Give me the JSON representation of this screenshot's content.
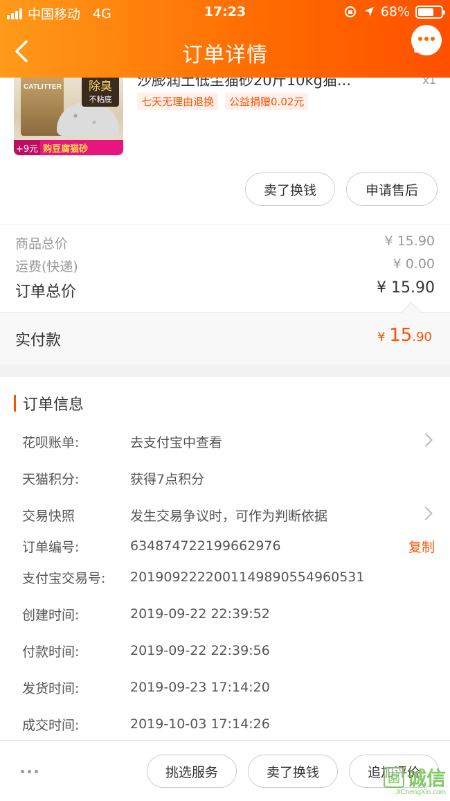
{
  "status_bar": {
    "carrier": "中国移动",
    "network": "4G",
    "time": "17:23",
    "battery_percent": "68%",
    "battery_level": 0.68
  },
  "nav": {
    "title": "订单详情",
    "back_icon": "chevron-left-icon",
    "more_icon": "more-dots-icon"
  },
  "product": {
    "title": "沙膨润土低尘猫砂20斤10kg猫...",
    "quantity": "x1",
    "image_tag_line1": "除臭",
    "image_tag_line2": "不粘底",
    "image_brand": "CATLITTER",
    "image_promo_price": "+9元",
    "image_promo_text": "购豆腐猫砂",
    "badges": [
      "七天无理由退换",
      "公益捐赠0.02元"
    ],
    "actions": [
      "卖了换钱",
      "申请售后"
    ]
  },
  "summary": {
    "goods_total_label": "商品总价",
    "goods_total_value": "¥ 15.90",
    "shipping_label": "运费(快递)",
    "shipping_value": "¥ 0.00",
    "order_total_label": "订单总价",
    "order_total_value": "¥ 15.90",
    "paid_label": "实付款",
    "paid_currency": "¥ ",
    "paid_integer": "15",
    "paid_decimal": ".90"
  },
  "order_info": {
    "section_title": "订单信息",
    "rows": [
      {
        "label": "花呗账单:",
        "value": "去支付宝中查看"
      },
      {
        "label": "天猫积分:",
        "value": "获得7点积分"
      },
      {
        "label": "交易快照",
        "value": "发生交易争议时，可作为判断依据"
      },
      {
        "label": "订单编号:",
        "value": "634874722199662976"
      },
      {
        "label": "支付宝交易号:",
        "value": "2019092222001149890554960531"
      },
      {
        "label": "创建时间:",
        "value": "2019-09-22 22:39:52"
      },
      {
        "label": "付款时间:",
        "value": "2019-09-22 22:39:56"
      },
      {
        "label": "发货时间:",
        "value": "2019-09-23 17:14:20"
      },
      {
        "label": "成交时间:",
        "value": "2019-10-03 17:14:26"
      }
    ],
    "copy_label": "复制"
  },
  "bottom_bar": {
    "buttons": [
      "挑选服务",
      "卖了换钱",
      "追加评价"
    ]
  },
  "watermark": {
    "text": "诚信",
    "sub": "JiChengXin.com"
  },
  "colors": {
    "accent": "#ff5000",
    "header_start": "#ff9a1a",
    "header_end": "#ff5000"
  }
}
